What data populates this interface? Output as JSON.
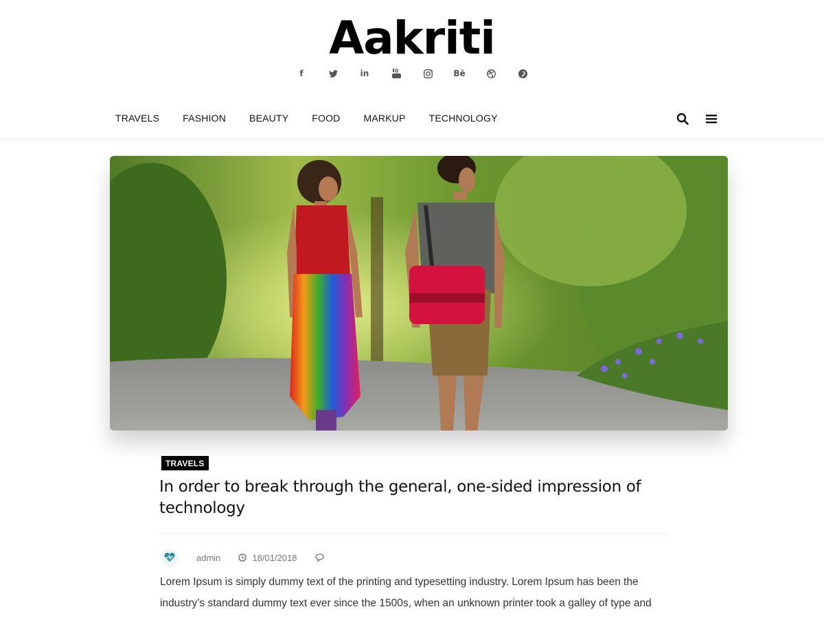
{
  "site": {
    "name": "Aakriti"
  },
  "social": [
    {
      "icon": "facebook-icon",
      "glyph": "f"
    },
    {
      "icon": "twitter-icon",
      "glyph": ""
    },
    {
      "icon": "linkedin-icon",
      "glyph": "in"
    },
    {
      "icon": "youtube-icon",
      "glyph": ""
    },
    {
      "icon": "instagram-icon",
      "glyph": ""
    },
    {
      "icon": "behance-icon",
      "glyph": "Bē"
    },
    {
      "icon": "dribbble-icon",
      "glyph": ""
    },
    {
      "icon": "pinterest-icon",
      "glyph": ""
    }
  ],
  "nav": {
    "items": [
      "TRAVELS",
      "FASHION",
      "BEAUTY",
      "FOOD",
      "MARKUP",
      "TECHNOLOGY"
    ],
    "search_icon": "search-icon",
    "menu_icon": "hamburger-menu-icon"
  },
  "post": {
    "category": "TRAVELS",
    "title": "In order to break through the general, one-sided impression of technology",
    "author": "admin",
    "date": "18/01/2018",
    "excerpt": "Lorem Ipsum is simply dummy text of the printing and typesetting industry. Lorem Ipsum has been the industry’s standard dummy text ever since the 1500s, when an unknown printer took a galley of type and"
  },
  "colors": {
    "text": "#111111",
    "muted": "#777777",
    "badge": "#000000",
    "border": "#ececec"
  }
}
